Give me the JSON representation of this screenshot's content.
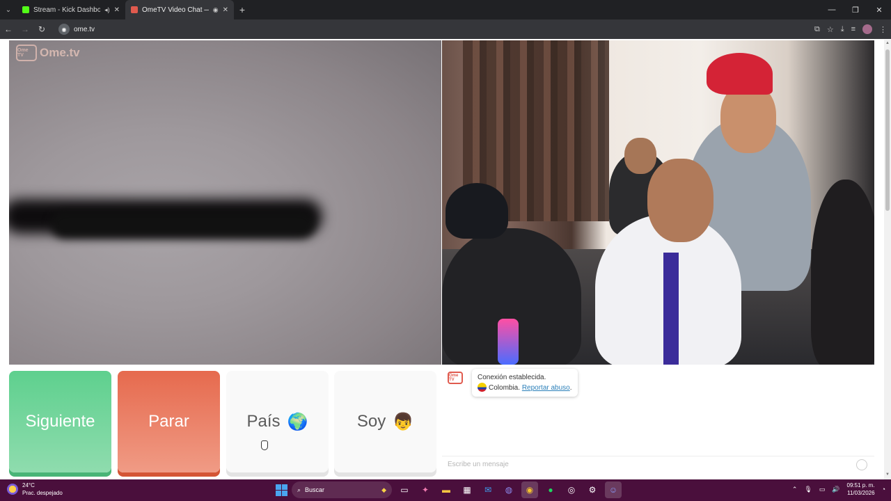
{
  "browser": {
    "tabs": [
      {
        "title": "Stream - Kick Dashboard",
        "favicon_color": "#53fc18",
        "active": false
      },
      {
        "title": "OmeTV Video Chat — Ome",
        "favicon_color": "#e05a4e",
        "active": true
      }
    ],
    "new_tab": "+",
    "url": "ome.tv"
  },
  "site": {
    "logo": "Ome.tv",
    "logo_badge": "Ome TV"
  },
  "controls": {
    "next": "Siguiente",
    "stop": "Parar",
    "country": "País",
    "country_emoji": "🌍",
    "gender": "Soy",
    "gender_emoji": "👦"
  },
  "chat": {
    "avatar": "Ome TV",
    "message": "Conexión establecida.",
    "country": "Colombia.",
    "report": "Reportar abuso",
    "report_suffix": ".",
    "placeholder": "Escribe un mensaje"
  },
  "taskbar": {
    "temperature": "24°C",
    "weather": "Prac. despejado",
    "search": "Buscar",
    "time": "09:51 p. m.",
    "date": "11/03/2026"
  },
  "colors": {
    "next": "#5ed08e",
    "stop": "#e66a4e",
    "taskbar": "#4a0f3c",
    "link": "#2a7fb9"
  }
}
